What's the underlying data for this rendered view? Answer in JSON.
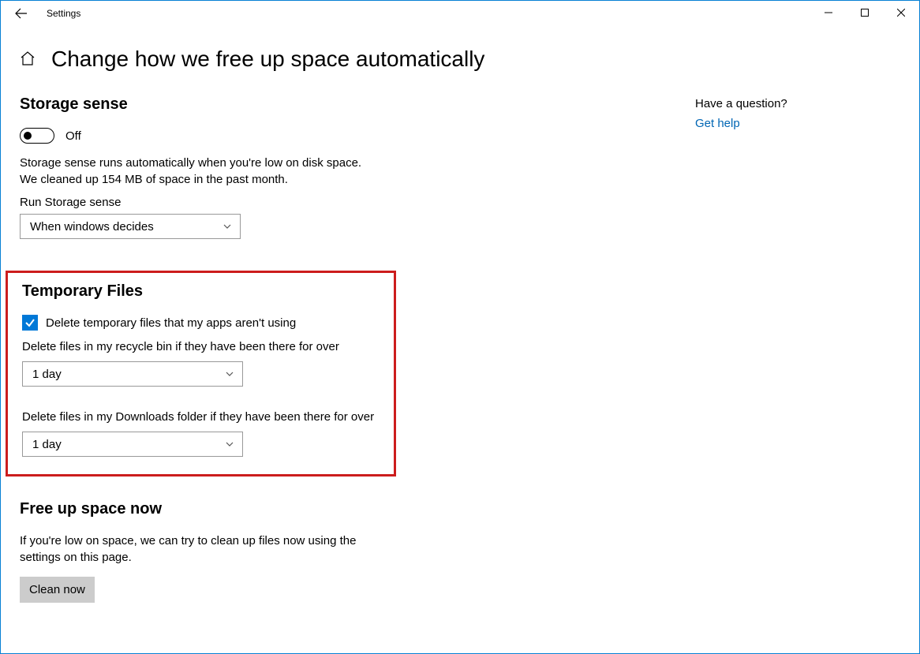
{
  "window": {
    "app_title": "Settings"
  },
  "header": {
    "title": "Change how we free up space automatically"
  },
  "storage_sense": {
    "heading": "Storage sense",
    "toggle_state": "Off",
    "desc_line1": "Storage sense runs automatically when you're low on disk space.",
    "desc_line2": "We cleaned up 154 MB of space in the past month.",
    "run_label": "Run Storage sense",
    "run_value": "When windows decides"
  },
  "temp_files": {
    "heading": "Temporary Files",
    "delete_temp_label": "Delete temporary files that my apps aren't using",
    "recycle_label": "Delete files in my recycle bin if they have been there for over",
    "recycle_value": "1 day",
    "downloads_label": "Delete files in my Downloads folder if they have been there for over",
    "downloads_value": "1 day"
  },
  "free_up": {
    "heading": "Free up space now",
    "desc_line1": "If you're low on space, we can try to clean up files now using the",
    "desc_line2": "settings on this page.",
    "button": "Clean now"
  },
  "sidebar_right": {
    "question": "Have a question?",
    "help_link": "Get help"
  }
}
